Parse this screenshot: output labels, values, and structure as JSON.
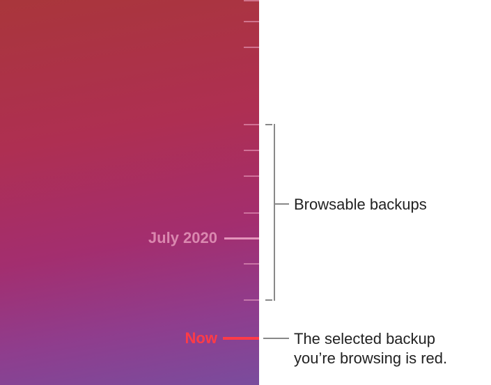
{
  "timeline": {
    "date_label": "July 2020",
    "now_label": "Now"
  },
  "callouts": {
    "browsable": "Browsable backups",
    "selected_line1": "The selected backup",
    "selected_line2": "you’re browsing is red."
  }
}
